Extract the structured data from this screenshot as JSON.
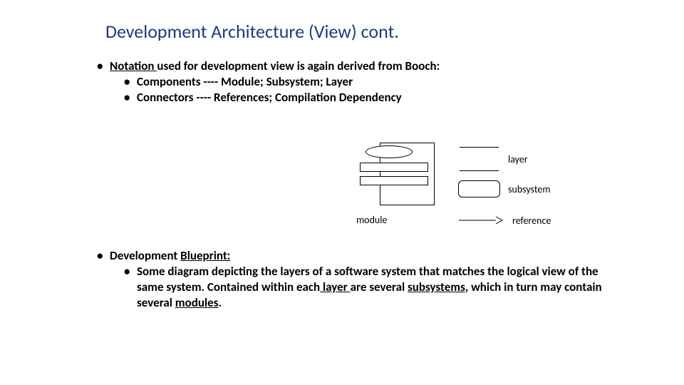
{
  "title": "Development Architecture (View) cont.",
  "top": {
    "line1_pre": "",
    "line1_u": "Notation ",
    "line1_post": "used for development view is again derived from Booch:",
    "comp": "Components ---- Module; Subsystem; Layer",
    "conn": "Connectors ---- References; Compilation Dependency"
  },
  "diagram": {
    "module": "module",
    "layer": "layer",
    "subsystem": "subsystem",
    "reference": "reference"
  },
  "bottom": {
    "dev": "Development ",
    "blueprint": "Blueprint:",
    "body1": "Some diagram depicting the layers of a software system that matches the logical view of the same system. Contained within each",
    "layer_w": " layer ",
    "body2": "are several ",
    "subs_w": "subsystems",
    "body3": ", which in turn may contain several ",
    "mods_w": "modules",
    "period": "."
  }
}
